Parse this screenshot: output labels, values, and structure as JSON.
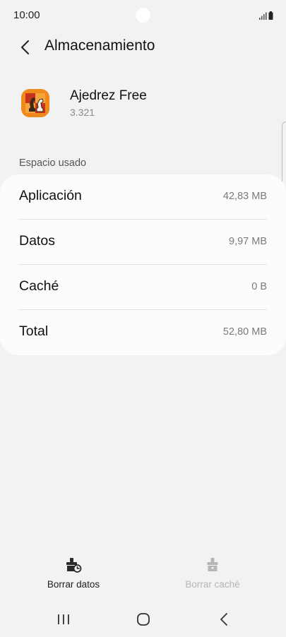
{
  "status_bar": {
    "time": "10:00"
  },
  "header": {
    "title": "Almacenamiento",
    "back_icon": "chevron-left-icon"
  },
  "app": {
    "name": "Ajedrez Free",
    "version": "3.321",
    "icon": "chess-app-icon"
  },
  "storage": {
    "section_label": "Espacio usado",
    "rows": [
      {
        "label": "Aplicación",
        "value": "42,83 MB"
      },
      {
        "label": "Datos",
        "value": "9,97 MB"
      },
      {
        "label": "Caché",
        "value": "0 B"
      },
      {
        "label": "Total",
        "value": "52,80 MB"
      }
    ]
  },
  "actions": {
    "clear_data": {
      "label": "Borrar datos",
      "icon": "clear-data-icon",
      "enabled": true
    },
    "clear_cache": {
      "label": "Borrar caché",
      "icon": "clear-cache-icon",
      "enabled": false
    }
  },
  "nav_bar": {
    "recents_icon": "recents-icon",
    "home_icon": "home-icon",
    "back_icon": "back-icon"
  },
  "colors": {
    "background": "#f2f2f2",
    "card": "#fcfcfc",
    "text_primary": "#111111",
    "text_secondary": "#7a7a7a",
    "disabled": "#b5b5b5",
    "app_icon_orange": "#f08a1c"
  }
}
